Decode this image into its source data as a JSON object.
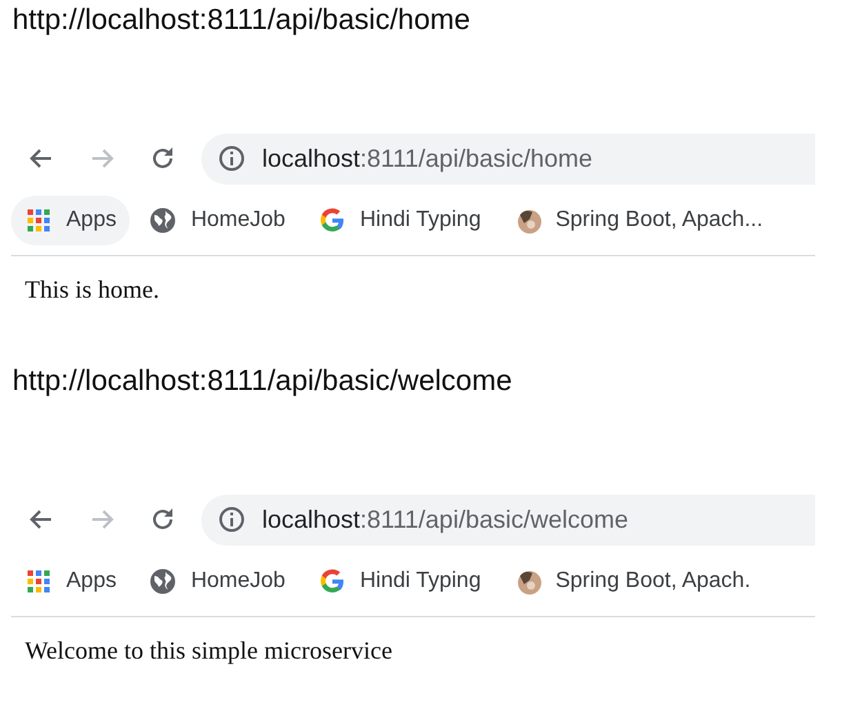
{
  "sections": [
    {
      "caption": "http://localhost:8111/api/basic/home",
      "browser": {
        "back_disabled": false,
        "forward_disabled": true,
        "address": {
          "host": "localhost",
          "path": ":8111/api/basic/home"
        },
        "bookmarks": [
          {
            "kind": "apps",
            "label": "Apps",
            "hovered": true
          },
          {
            "kind": "globe",
            "label": "HomeJob",
            "hovered": false
          },
          {
            "kind": "google",
            "label": "Hindi Typing",
            "hovered": false
          },
          {
            "kind": "favicon",
            "label": "Spring Boot, Apach...",
            "hovered": false
          }
        ]
      },
      "content": "This is home."
    },
    {
      "caption": "http://localhost:8111/api/basic/welcome",
      "browser": {
        "back_disabled": false,
        "forward_disabled": true,
        "address": {
          "host": "localhost",
          "path": ":8111/api/basic/welcome"
        },
        "bookmarks": [
          {
            "kind": "apps",
            "label": "Apps",
            "hovered": false
          },
          {
            "kind": "globe",
            "label": "HomeJob",
            "hovered": false
          },
          {
            "kind": "google",
            "label": "Hindi Typing",
            "hovered": false
          },
          {
            "kind": "favicon",
            "label": "Spring Boot, Apach.",
            "hovered": false
          }
        ]
      },
      "content": "Welcome to this simple microservice"
    }
  ]
}
